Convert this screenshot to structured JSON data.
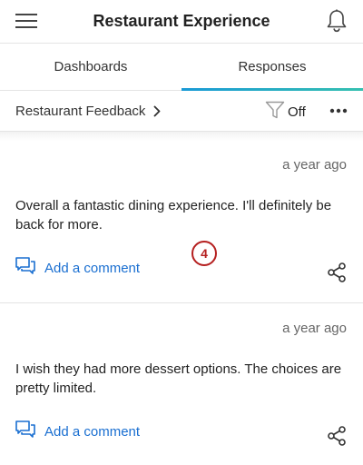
{
  "header": {
    "title": "Restaurant Experience",
    "menu_icon": "hamburger-menu-icon",
    "notification_icon": "bell-icon"
  },
  "tabs": [
    {
      "label": "Dashboards",
      "active": false
    },
    {
      "label": "Responses",
      "active": true
    }
  ],
  "subbar": {
    "survey_name": "Restaurant Feedback",
    "filter_state": "Off",
    "filter_icon": "funnel-icon",
    "more_icon": "more-dots-icon"
  },
  "responses": [
    {
      "time": "a year ago",
      "text": "Overall a fantastic dining experience. I'll definitely be back for more.",
      "comment_label": "Add a comment"
    },
    {
      "time": "a year ago",
      "text": "I wish they had more dessert options. The choices are pretty limited.",
      "comment_label": "Add a comment"
    }
  ],
  "step_badge": "4",
  "colors": {
    "accent_blue": "#1a6fd1",
    "tab_gradient_start": "#1a9ad6",
    "tab_gradient_end": "#35c0b0",
    "badge_red": "#b51f1f"
  }
}
